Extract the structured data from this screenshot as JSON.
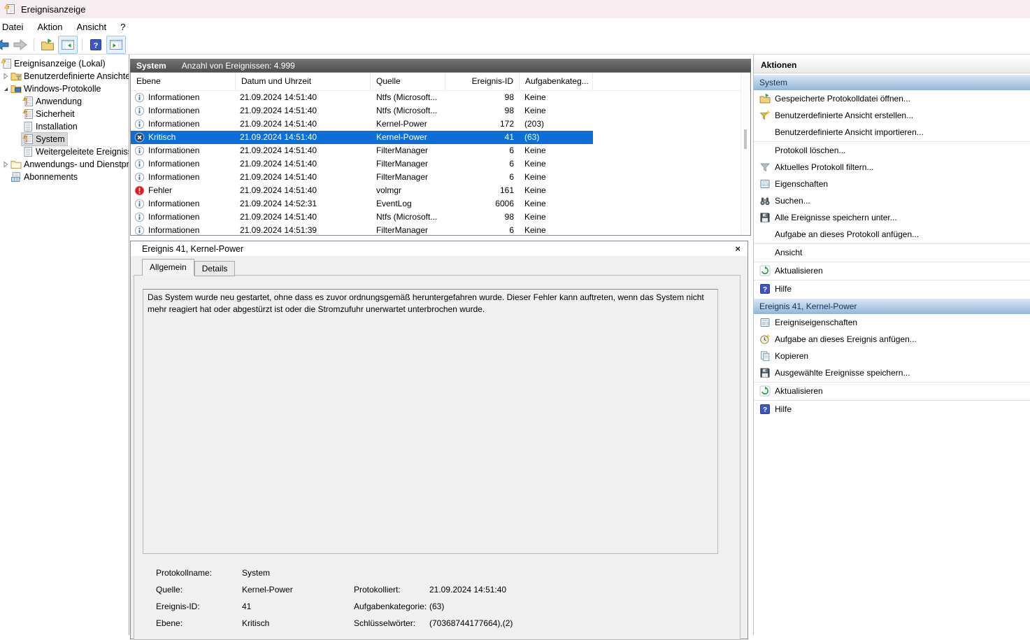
{
  "window": {
    "title": "Ereignisanzeige"
  },
  "menu": {
    "items": [
      "Datei",
      "Aktion",
      "Ansicht",
      "?"
    ]
  },
  "toolbar": {
    "buttons": [
      "back",
      "forward",
      "open-saved-log",
      "toggle-console-tree",
      "help",
      "toggle-action-pane"
    ]
  },
  "sidebar": {
    "items": [
      {
        "label": "Ereignisanzeige (Lokal)",
        "icon": "event-viewer",
        "level": 0,
        "expander": "none",
        "selected": false
      },
      {
        "label": "Benutzerdefinierte Ansichten",
        "icon": "folder-filter",
        "level": 1,
        "expander": "collapsed",
        "selected": false
      },
      {
        "label": "Windows-Protokolle",
        "icon": "folder-monitor",
        "level": 1,
        "expander": "expanded",
        "selected": false
      },
      {
        "label": "Anwendung",
        "icon": "log-badged",
        "level": 2,
        "expander": "none",
        "selected": false
      },
      {
        "label": "Sicherheit",
        "icon": "log-badged",
        "level": 2,
        "expander": "none",
        "selected": false
      },
      {
        "label": "Installation",
        "icon": "log-plain",
        "level": 2,
        "expander": "none",
        "selected": false
      },
      {
        "label": "System",
        "icon": "log-badged",
        "level": 2,
        "expander": "none",
        "selected": true
      },
      {
        "label": "Weitergeleitete Ereignisse",
        "icon": "log-plain",
        "level": 2,
        "expander": "none",
        "selected": false
      },
      {
        "label": "Anwendungs- und Dienstprotokolle",
        "icon": "folder-plain",
        "level": 1,
        "expander": "collapsed",
        "selected": false
      },
      {
        "label": "Abonnements",
        "icon": "subscriptions",
        "level": 1,
        "expander": "none",
        "selected": false
      }
    ]
  },
  "list": {
    "title": "System",
    "count": "Anzahl von Ereignissen: 4.999",
    "columns": [
      "Ebene",
      "Datum und Uhrzeit",
      "Quelle",
      "Ereignis-ID",
      "Aufgabenkateg..."
    ],
    "rows": [
      {
        "icon": "info",
        "level": "Informationen",
        "datetime": "21.09.2024 14:51:40",
        "source": "Ntfs (Microsoft...",
        "id": "98",
        "category": "Keine",
        "selected": false
      },
      {
        "icon": "info",
        "level": "Informationen",
        "datetime": "21.09.2024 14:51:40",
        "source": "Ntfs (Microsoft...",
        "id": "98",
        "category": "Keine",
        "selected": false
      },
      {
        "icon": "info",
        "level": "Informationen",
        "datetime": "21.09.2024 14:51:40",
        "source": "Kernel-Power",
        "id": "172",
        "category": "(203)",
        "selected": false
      },
      {
        "icon": "critical",
        "level": "Kritisch",
        "datetime": "21.09.2024 14:51:40",
        "source": "Kernel-Power",
        "id": "41",
        "category": "(63)",
        "selected": true
      },
      {
        "icon": "info",
        "level": "Informationen",
        "datetime": "21.09.2024 14:51:40",
        "source": "FilterManager",
        "id": "6",
        "category": "Keine",
        "selected": false
      },
      {
        "icon": "info",
        "level": "Informationen",
        "datetime": "21.09.2024 14:51:40",
        "source": "FilterManager",
        "id": "6",
        "category": "Keine",
        "selected": false
      },
      {
        "icon": "info",
        "level": "Informationen",
        "datetime": "21.09.2024 14:51:40",
        "source": "FilterManager",
        "id": "6",
        "category": "Keine",
        "selected": false
      },
      {
        "icon": "error",
        "level": "Fehler",
        "datetime": "21.09.2024 14:51:40",
        "source": "volmgr",
        "id": "161",
        "category": "Keine",
        "selected": false
      },
      {
        "icon": "info",
        "level": "Informationen",
        "datetime": "21.09.2024 14:52:31",
        "source": "EventLog",
        "id": "6006",
        "category": "Keine",
        "selected": false
      },
      {
        "icon": "info",
        "level": "Informationen",
        "datetime": "21.09.2024 14:51:40",
        "source": "Ntfs (Microsoft...",
        "id": "98",
        "category": "Keine",
        "selected": false
      },
      {
        "icon": "info",
        "level": "Informationen",
        "datetime": "21.09.2024 14:51:39",
        "source": "FilterManager",
        "id": "6",
        "category": "Keine",
        "selected": false
      }
    ]
  },
  "detail": {
    "title": "Ereignis 41, Kernel-Power",
    "close_label": "×",
    "tabs": [
      "Allgemein",
      "Details"
    ],
    "active_tab": 0,
    "description": "Das System wurde neu gestartet, ohne dass es zuvor ordnungsgemäß heruntergefahren wurde. Dieser Fehler kann auftreten, wenn das System nicht mehr reagiert hat oder abgestürzt ist oder die Stromzufuhr unerwartet unterbrochen wurde.",
    "fields": [
      {
        "l1": "Protokollname:",
        "v1": "System",
        "l2": "",
        "v2": ""
      },
      {
        "l1": "Quelle:",
        "v1": "Kernel-Power",
        "l2": "Protokolliert:",
        "v2": "21.09.2024 14:51:40"
      },
      {
        "l1": "Ereignis-ID:",
        "v1": "41",
        "l2": "Aufgabenkategorie:",
        "v2": "(63)"
      },
      {
        "l1": "Ebene:",
        "v1": "Kritisch",
        "l2": "Schlüsselwörter:",
        "v2": "(70368744177664),(2)"
      }
    ]
  },
  "actions": {
    "header": "Aktionen",
    "groups": [
      {
        "title": "System",
        "items": [
          {
            "label": "Gespeicherte Protokolldatei öffnen...",
            "icon": "act-open",
            "sep": false
          },
          {
            "label": "Benutzerdefinierte Ansicht erstellen...",
            "icon": "act-filter-new",
            "sep": false
          },
          {
            "label": "Benutzerdefinierte Ansicht importieren...",
            "icon": "",
            "sep": false
          },
          {
            "label": "Protokoll löschen...",
            "icon": "",
            "sep": true
          },
          {
            "label": "Aktuelles Protokoll filtern...",
            "icon": "act-filter",
            "sep": false
          },
          {
            "label": "Eigenschaften",
            "icon": "act-props",
            "sep": false
          },
          {
            "label": "Suchen...",
            "icon": "act-search",
            "sep": false
          },
          {
            "label": "Alle Ereignisse speichern unter...",
            "icon": "act-save",
            "sep": false
          },
          {
            "label": "Aufgabe an dieses Protokoll anfügen...",
            "icon": "",
            "sep": false
          },
          {
            "label": "Ansicht",
            "icon": "",
            "sep": true
          },
          {
            "label": "Aktualisieren",
            "icon": "act-refresh",
            "sep": true
          },
          {
            "label": "Hilfe",
            "icon": "act-help",
            "sep": true
          }
        ]
      },
      {
        "title": "Ereignis 41, Kernel-Power",
        "items": [
          {
            "label": "Ereigniseigenschaften",
            "icon": "act-props",
            "sep": false
          },
          {
            "label": "Aufgabe an dieses Ereignis anfügen...",
            "icon": "act-task",
            "sep": false
          },
          {
            "label": "Kopieren",
            "icon": "act-copy",
            "sep": false
          },
          {
            "label": "Ausgewählte Ereignisse speichern...",
            "icon": "act-save",
            "sep": false
          },
          {
            "label": "Aktualisieren",
            "icon": "act-refresh",
            "sep": true
          },
          {
            "label": "Hilfe",
            "icon": "act-help",
            "sep": true
          }
        ]
      }
    ]
  },
  "colors": {
    "selection_blue": "#0c6ed6",
    "list_header_gray": "#5a5a5a",
    "group_header_blue": "#93b5d7",
    "error_red": "#d81e1e",
    "critical_navy": "#2d4a66",
    "titlebar_tint": "#f7edf0"
  }
}
